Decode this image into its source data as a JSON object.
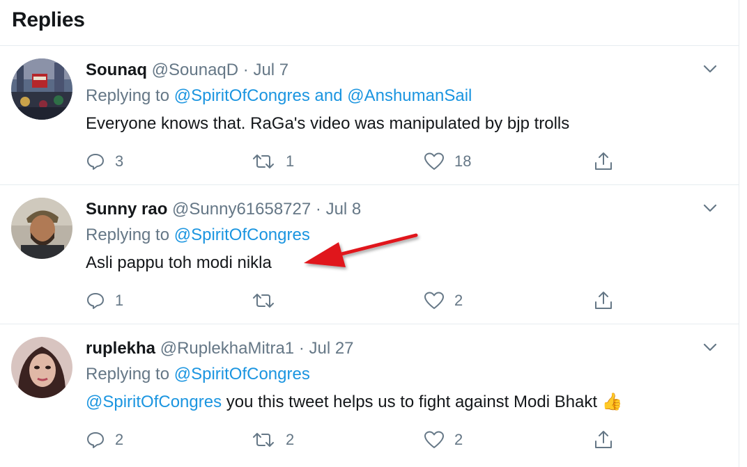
{
  "header": {
    "title": "Replies"
  },
  "tweets": [
    {
      "name": "Sounaq",
      "handle": "@SounaqD",
      "date": "· Jul 7",
      "replying_prefix": "Replying to",
      "replying_to_1": "@SpiritOfCongres",
      "replying_joiner": "and",
      "replying_to_2": "@AnshumanSail",
      "text": "Everyone knows that. RaGa's video was manipulated by bjp trolls",
      "reply_count": "3",
      "retweet_count": "1",
      "like_count": "18"
    },
    {
      "name": "Sunny rao",
      "handle": "@Sunny61658727",
      "date": "· Jul 8",
      "replying_prefix": "Replying to",
      "replying_to_1": "@SpiritOfCongres",
      "text": "Asli pappu toh modi nikla",
      "reply_count": "1",
      "retweet_count": "",
      "like_count": "2"
    },
    {
      "name": "ruplekha",
      "handle": "@RuplekhaMitra1",
      "date": "· Jul 27",
      "replying_prefix": "Replying to",
      "replying_to_1": "@SpiritOfCongres",
      "text_mention": "@SpiritOfCongres",
      "text": "you this tweet helps us to fight against Modi Bhakt",
      "text_emoji": "👍",
      "reply_count": "2",
      "retweet_count": "2",
      "like_count": "2"
    }
  ],
  "colors": {
    "link": "#1b95e0",
    "muted": "#657786",
    "text": "#14171a",
    "divider": "#e6ecf0",
    "annotation_arrow": "#e0141b"
  },
  "icons": [
    "chevron-down-icon",
    "reply-icon",
    "retweet-icon",
    "like-icon",
    "share-icon",
    "red-arrow-annotation"
  ]
}
